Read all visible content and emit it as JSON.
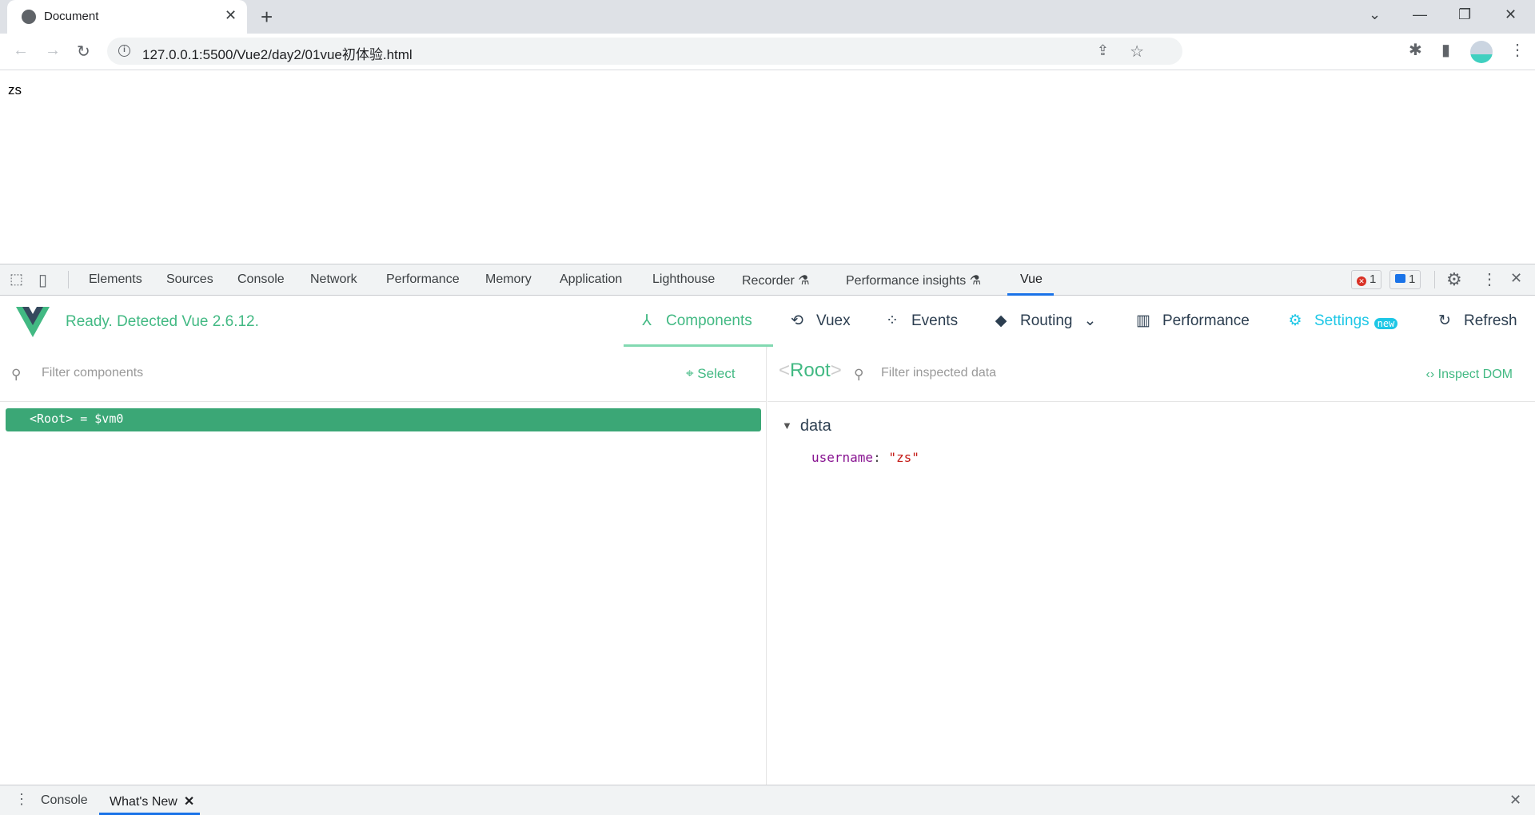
{
  "browser": {
    "tab_title": "Document",
    "tab_close": "✕",
    "new_tab": "+",
    "window_controls": {
      "tab_search": "⌄",
      "minimize": "—",
      "restore": "❐",
      "close": "✕"
    },
    "nav": {
      "back": "←",
      "forward": "→",
      "reload": "↻"
    },
    "url": "127.0.0.1:5500/Vue2/day2/01vue初体验.html",
    "site_info": "i",
    "share_icon": "⇪",
    "bookmark_icon": "☆",
    "extensions_icon": "✱",
    "side_panel_icon": "▮",
    "menu_icon": "⋮"
  },
  "page": {
    "content_text": "zs"
  },
  "devtools": {
    "tabs": [
      {
        "label": "Elements"
      },
      {
        "label": "Sources"
      },
      {
        "label": "Console"
      },
      {
        "label": "Network"
      },
      {
        "label": "Performance"
      },
      {
        "label": "Memory"
      },
      {
        "label": "Application"
      },
      {
        "label": "Lighthouse"
      },
      {
        "label": "Recorder ⚗"
      },
      {
        "label": "Performance insights ⚗"
      },
      {
        "label": "Vue"
      }
    ],
    "active_tab": "Vue",
    "error_count": "1",
    "message_count": "1",
    "settings_icon": "⚙",
    "more_icon": "⋮",
    "close_icon": "✕",
    "inspect_icon": "⬚",
    "device_icon": "▯"
  },
  "vue": {
    "status": "Ready. Detected Vue 2.6.12.",
    "nav": [
      {
        "label": "Components",
        "icon": "⅄"
      },
      {
        "label": "Vuex",
        "icon": "⟲"
      },
      {
        "label": "Events",
        "icon": "⁘"
      },
      {
        "label": "Routing",
        "icon": "◆"
      },
      {
        "label": "Performance",
        "icon": "▥"
      },
      {
        "label": "Settings",
        "icon": "⚙"
      },
      {
        "label": "Refresh",
        "icon": "↻"
      }
    ],
    "routing_chevron": "⌄",
    "settings_badge": "new",
    "colors": {
      "accent": "#42b983",
      "selected_row": "#3ba776",
      "settings": "#1ec7e6",
      "dark": "#2c3e50"
    },
    "components_pane": {
      "filter_placeholder": "Filter components",
      "select_label": "Select",
      "tree": [
        {
          "label": "<Root> = $vm0",
          "selected": true
        }
      ]
    },
    "inspector_pane": {
      "title_open": "<",
      "title": "Root",
      "title_close": ">",
      "filter_placeholder": "Filter inspected data",
      "inspect_dom_label": "Inspect DOM",
      "section": "data",
      "fields": [
        {
          "key": "username",
          "value": "\"zs\""
        }
      ]
    }
  },
  "drawer": {
    "tabs": [
      {
        "label": "Console"
      },
      {
        "label": "What's New"
      }
    ],
    "active_tab": "What's New",
    "tab_close": "✕",
    "menu_icon": "⋮",
    "close_icon": "✕"
  }
}
